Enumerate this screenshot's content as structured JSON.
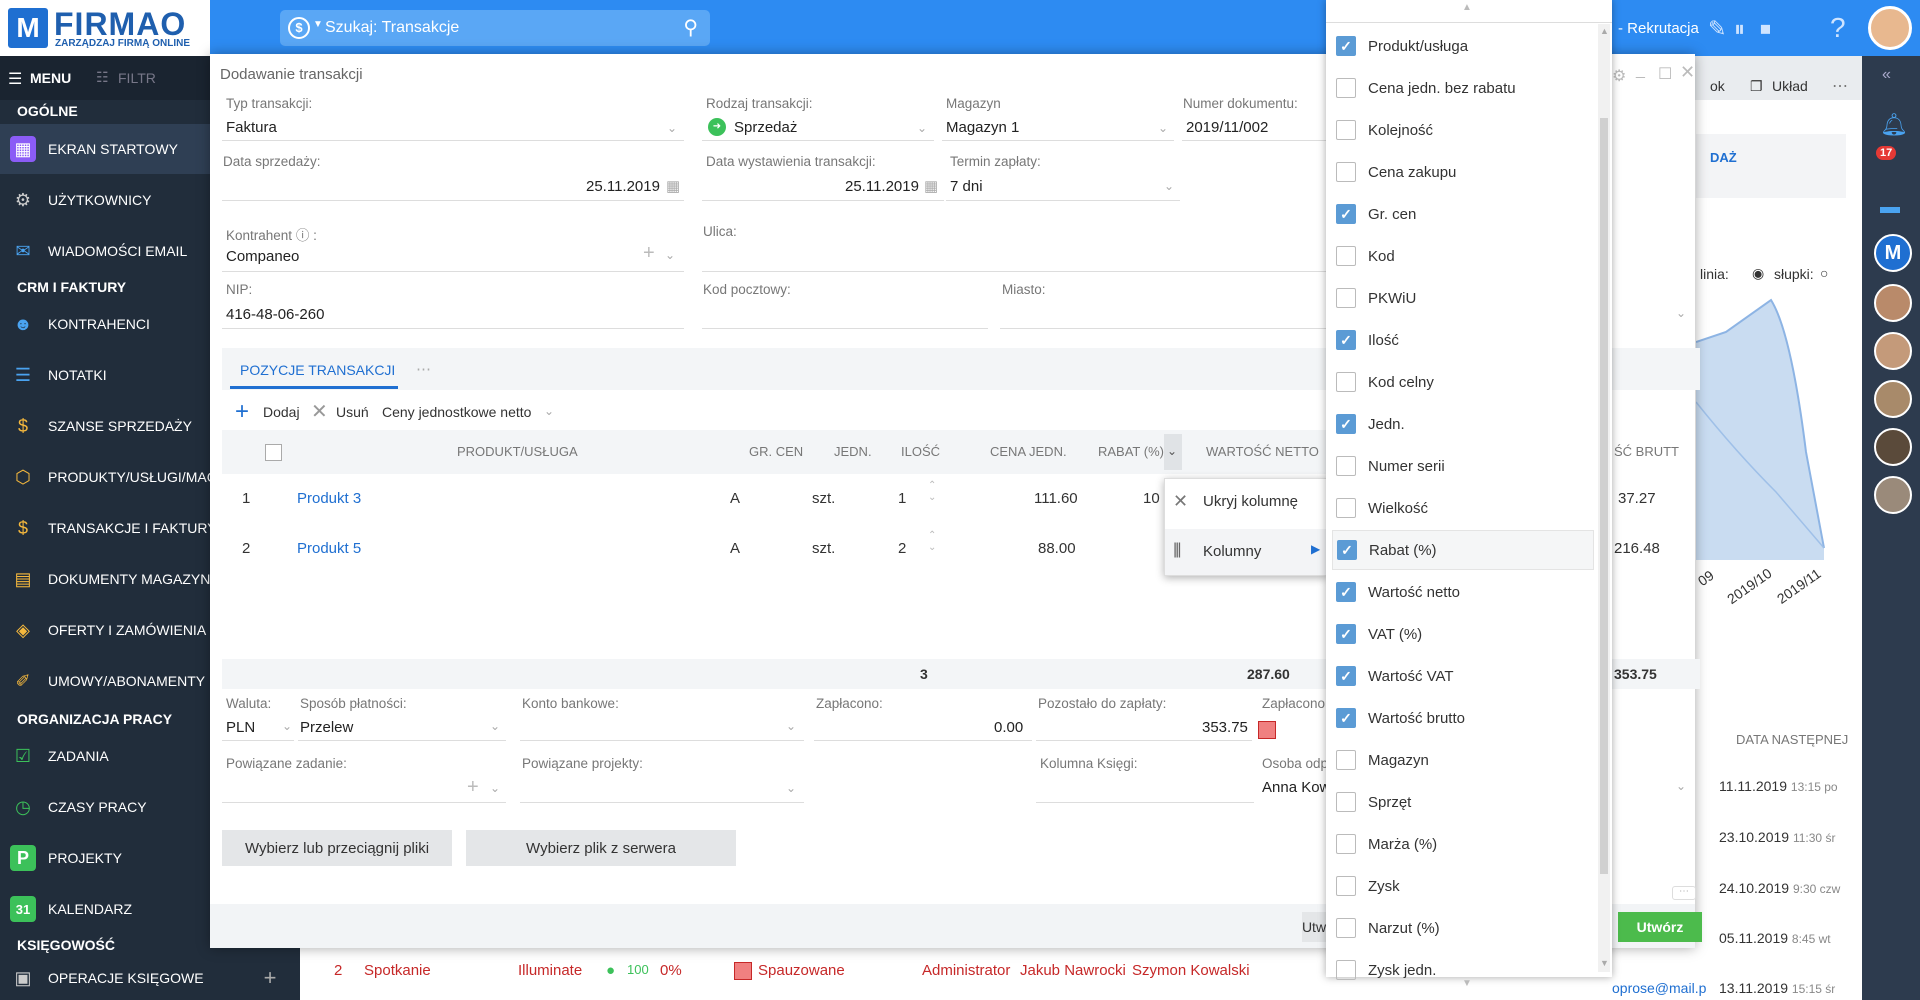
{
  "app": {
    "brand": "FIRMAO",
    "tagline": "ZARZĄDZAJ FIRMĄ ONLINE",
    "breadcrumb": "- Rekrutacja"
  },
  "search": {
    "placeholder": "Szukaj: Transakcje"
  },
  "toolbar": {
    "menu": "MENU",
    "filter": "FILTR"
  },
  "sidebar": {
    "sections": [
      "OGÓLNE",
      "CRM I FAKTURY",
      "ORGANIZACJA PRACY",
      "KSIĘGOWOŚĆ"
    ],
    "items": [
      {
        "label": "EKRAN STARTOWY",
        "icon": "grid-icon"
      },
      {
        "label": "UŻYTKOWNICY",
        "icon": "users-icon"
      },
      {
        "label": "WIADOMOŚCI EMAIL",
        "icon": "mail-icon"
      },
      {
        "label": "KONTRAHENCI",
        "icon": "contacts-icon"
      },
      {
        "label": "NOTATKI",
        "icon": "notes-icon"
      },
      {
        "label": "SZANSE SPRZEDAŻY",
        "icon": "money-bag-icon"
      },
      {
        "label": "PRODUKTY/USŁUGI/MAGAZYN",
        "icon": "box-icon"
      },
      {
        "label": "TRANSAKCJE I FAKTURY",
        "icon": "dollar-icon"
      },
      {
        "label": "DOKUMENTY MAGAZYNOWE",
        "icon": "document-icon"
      },
      {
        "label": "OFERTY I ZAMÓWIENIA",
        "icon": "tag-icon"
      },
      {
        "label": "UMOWY/ABONAMENTY",
        "icon": "contract-icon"
      },
      {
        "label": "ZADANIA",
        "icon": "check-icon"
      },
      {
        "label": "CZASY PRACY",
        "icon": "clock-icon"
      },
      {
        "label": "PROJEKTY",
        "icon": "projects-icon"
      },
      {
        "label": "KALENDARZ",
        "icon": "calendar-icon"
      },
      {
        "label": "OPERACJE KSIĘGOWE",
        "icon": "ledger-icon"
      }
    ]
  },
  "modal": {
    "title": "Dodawanie transakcji",
    "fields": {
      "typ_label": "Typ transakcji:",
      "typ_value": "Faktura",
      "rodzaj_label": "Rodzaj transakcji:",
      "rodzaj_value": "Sprzedaż",
      "magazyn_label": "Magazyn",
      "magazyn_value": "Magazyn 1",
      "numer_label": "Numer dokumentu:",
      "numer_value": "2019/11/002",
      "data_sprzedazy_label": "Data sprzedaży:",
      "data_sprzedazy_value": "25.11.2019",
      "data_wystawienia_label": "Data wystawienia transakcji:",
      "data_wystawienia_value": "25.11.2019",
      "termin_label": "Termin zapłaty:",
      "termin_value": "7 dni",
      "kontrahent_label": "Kontrahent",
      "kontrahent_value": "Companeo",
      "ulica_label": "Ulica:",
      "nip_label": "NIP:",
      "nip_value": "416-48-06-260",
      "kod_label": "Kod pocztowy:",
      "miasto_label": "Miasto:"
    },
    "tab": "POZYCJE TRANSAKCJI",
    "actions": {
      "add": "Dodaj",
      "remove": "Usuń",
      "prices": "Ceny jednostkowe netto"
    },
    "columns": [
      "PRODUKT/USŁUGA",
      "GR. CEN",
      "JEDN.",
      "ILOŚĆ",
      "CENA JEDN.",
      "RABAT (%)",
      "WARTOŚĆ NETTO",
      "ŚĆ BRUTT"
    ],
    "rows": [
      {
        "no": "1",
        "product": "Produkt 3",
        "gr": "A",
        "unit": "szt.",
        "qty": "1",
        "price": "111.60",
        "discount": "10",
        "gross": "37.27"
      },
      {
        "no": "2",
        "product": "Produkt 5",
        "gr": "A",
        "unit": "szt.",
        "qty": "2",
        "price": "88.00",
        "discount": "",
        "gross": "216.48"
      }
    ],
    "totals": {
      "qty": "3",
      "net": "287.60",
      "gross": "353.75"
    },
    "payment": {
      "waluta_label": "Waluta:",
      "waluta_value": "PLN",
      "sposob_label": "Sposób płatności:",
      "sposob_value": "Przelew",
      "konto_label": "Konto bankowe:",
      "zaplacono_label": "Zapłacono:",
      "zaplacono_value": "0.00",
      "pozostalo_label": "Pozostało do zapłaty:",
      "pozostalo_value": "353.75",
      "zaplacono2_label": "Zapłacono"
    },
    "links": {
      "zadanie_label": "Powiązane zadanie:",
      "projekty_label": "Powiązane projekty:",
      "kolumna_label": "Kolumna Księgi:",
      "osoba_label": "Osoba odp",
      "osoba_value": "Anna Kow"
    },
    "buttons": {
      "files": "Wybierz lub przeciągnij pliki",
      "server": "Wybierz plik z serwera",
      "create": "Utwórz",
      "create_partial": "Utw"
    }
  },
  "context_menu": {
    "hide": "Ukryj kolumnę",
    "columns": "Kolumny"
  },
  "column_options": [
    {
      "label": "Produkt/usługa",
      "checked": true
    },
    {
      "label": "Cena jedn. bez rabatu",
      "checked": false
    },
    {
      "label": "Kolejność",
      "checked": false
    },
    {
      "label": "Cena zakupu",
      "checked": false
    },
    {
      "label": "Gr. cen",
      "checked": true
    },
    {
      "label": "Kod",
      "checked": false
    },
    {
      "label": "PKWiU",
      "checked": false
    },
    {
      "label": "Ilość",
      "checked": true
    },
    {
      "label": "Kod celny",
      "checked": false
    },
    {
      "label": "Jedn.",
      "checked": true
    },
    {
      "label": "Numer serii",
      "checked": false
    },
    {
      "label": "Wielkość",
      "checked": false
    },
    {
      "label": "Rabat (%)",
      "checked": true
    },
    {
      "label": "Wartość netto",
      "checked": true
    },
    {
      "label": "VAT (%)",
      "checked": true
    },
    {
      "label": "Wartość VAT",
      "checked": true
    },
    {
      "label": "Wartość brutto",
      "checked": true
    },
    {
      "label": "Magazyn",
      "checked": false
    },
    {
      "label": "Sprzęt",
      "checked": false
    },
    {
      "label": "Marża (%)",
      "checked": false
    },
    {
      "label": "Zysk",
      "checked": false
    },
    {
      "label": "Narzut (%)",
      "checked": false
    },
    {
      "label": "Zysk jedn.",
      "checked": false
    }
  ],
  "background": {
    "ok": "ok",
    "layout": "Układ",
    "daz": "DAŻ",
    "chart_legend": {
      "line": "linia:",
      "bars": "słupki:"
    },
    "chart_ticks": [
      "09",
      "2019/10",
      "2019/11"
    ],
    "next_date_header": "DATA NASTĘPNEJ",
    "dates": [
      {
        "date": "11.11.2019",
        "time": "13:15 po"
      },
      {
        "date": "23.10.2019",
        "time": "11:30 śr"
      },
      {
        "date": "24.10.2019",
        "time": "9:30 czw"
      },
      {
        "date": "05.11.2019",
        "time": "8:45 wt"
      },
      {
        "date": "13.11.2019",
        "time": "15:15 śr"
      }
    ],
    "notifications": "17",
    "bottom_row": {
      "no": "2",
      "type": "Spotkanie",
      "company": "Illuminate",
      "progress": "100",
      "percent": "0%",
      "status": "Spauzowane",
      "people": [
        "Administrator",
        "Jakub Nawrocki",
        "Szymon Kowalski"
      ],
      "email": "oprose@mail.p"
    }
  },
  "colors": {
    "accent": "#2d8bf2",
    "sidebar": "#212d3b",
    "link": "#1f6fd1",
    "create": "#4cbb4c"
  }
}
